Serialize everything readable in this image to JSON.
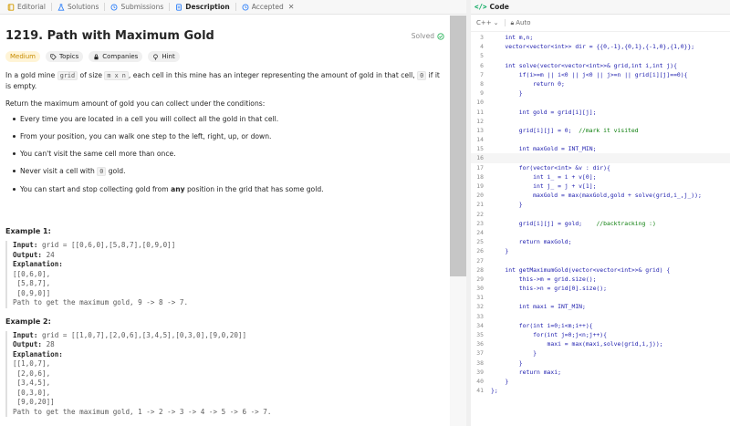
{
  "tabs": [
    {
      "label": "Editorial",
      "icon": "book-icon",
      "active": false
    },
    {
      "label": "Solutions",
      "icon": "flask-icon",
      "active": false
    },
    {
      "label": "Submissions",
      "icon": "history-icon",
      "active": false
    },
    {
      "label": "Description",
      "icon": "document-icon",
      "active": true
    },
    {
      "label": "Accepted",
      "icon": "history-icon",
      "active": false,
      "closable": true
    }
  ],
  "problem": {
    "title": "1219. Path with Maximum Gold",
    "solved_label": "Solved",
    "difficulty": "Medium",
    "tags": [
      "Topics",
      "Companies",
      "Hint"
    ],
    "description_parts": [
      "In a gold mine ",
      "grid",
      " of size ",
      "m x n",
      ", each cell in this mine has an integer representing the amount of gold in that cell, ",
      "0",
      " if it is empty."
    ],
    "return_text": "Return the maximum amount of gold you can collect under the conditions:",
    "rules": [
      {
        "pre": "Every time you are located in a cell you will collect all the gold in that cell.",
        "code": "",
        "bold": "",
        "post": ""
      },
      {
        "pre": "From your position, you can walk one step to the left, right, up, or down.",
        "code": "",
        "bold": "",
        "post": ""
      },
      {
        "pre": "You can't visit the same cell more than once.",
        "code": "",
        "bold": "",
        "post": ""
      },
      {
        "pre": "Never visit a cell with ",
        "code": "0",
        "bold": "",
        "post": " gold."
      },
      {
        "pre": "You can start and stop collecting gold from ",
        "code": "",
        "bold": "any",
        "post": " position in the grid that has some gold."
      }
    ],
    "examples": [
      {
        "title": "Example 1:",
        "input_label": "Input:",
        "input": " grid = [[0,6,0],[5,8,7],[0,9,0]]",
        "output_label": "Output:",
        "output": " 24",
        "explanation_label": "Explanation:",
        "explanation_lines": [
          "[[0,6,0],",
          " [5,8,7],",
          " [0,9,0]]",
          "Path to get the maximum gold, 9 -> 8 -> 7."
        ]
      },
      {
        "title": "Example 2:",
        "input_label": "Input:",
        "input": " grid = [[1,0,7],[2,0,6],[3,4,5],[0,3,0],[9,0,20]]",
        "output_label": "Output:",
        "output": " 28",
        "explanation_label": "Explanation:",
        "explanation_lines": [
          "[[1,0,7],",
          " [2,0,6],",
          " [3,4,5],",
          " [0,3,0],",
          " [9,0,20]]",
          "Path to get the maximum gold, 1 -> 2 -> 3 -> 4 -> 5 -> 6 -> 7."
        ]
      }
    ]
  },
  "code_panel": {
    "title": "Code",
    "language": "C++",
    "mode": "Auto",
    "lines": [
      {
        "n": "3",
        "t": "    int m,n;"
      },
      {
        "n": "4",
        "t": "    vector<vector<int>> dir = {{0,-1},{0,1},{-1,0},{1,0}};"
      },
      {
        "n": "5",
        "t": ""
      },
      {
        "n": "6",
        "t": "    int solve(vector<vector<int>>& grid,int i,int j){"
      },
      {
        "n": "7",
        "t": "        if(i>=m || i<0 || j<0 || j>=n || grid[i][j]==0){"
      },
      {
        "n": "8",
        "t": "            return 0;"
      },
      {
        "n": "9",
        "t": "        }"
      },
      {
        "n": "10",
        "t": ""
      },
      {
        "n": "11",
        "t": "        int gold = grid[i][j];"
      },
      {
        "n": "12",
        "t": ""
      },
      {
        "n": "13",
        "t": "        grid[i][j] = 0;  //mark it visited"
      },
      {
        "n": "14",
        "t": ""
      },
      {
        "n": "15",
        "t": "        int maxGold = INT_MIN;"
      },
      {
        "n": "16",
        "t": ""
      },
      {
        "n": "17",
        "t": "        for(vector<int> &v : dir){"
      },
      {
        "n": "18",
        "t": "            int i_ = i + v[0];"
      },
      {
        "n": "19",
        "t": "            int j_ = j + v[1];"
      },
      {
        "n": "20",
        "t": "            maxGold = max(maxGold,gold + solve(grid,i_,j_));"
      },
      {
        "n": "21",
        "t": "        }"
      },
      {
        "n": "22",
        "t": ""
      },
      {
        "n": "23",
        "t": "        grid[i][j] = gold;    //backtracking :)"
      },
      {
        "n": "24",
        "t": ""
      },
      {
        "n": "25",
        "t": "        return maxGold;"
      },
      {
        "n": "26",
        "t": "    }"
      },
      {
        "n": "27",
        "t": ""
      },
      {
        "n": "28",
        "t": "    int getMaximumGold(vector<vector<int>>& grid) {"
      },
      {
        "n": "29",
        "t": "        this->m = grid.size();"
      },
      {
        "n": "30",
        "t": "        this->n = grid[0].size();"
      },
      {
        "n": "31",
        "t": ""
      },
      {
        "n": "32",
        "t": "        int maxi = INT_MIN;"
      },
      {
        "n": "33",
        "t": ""
      },
      {
        "n": "34",
        "t": "        for(int i=0;i<m;i++){"
      },
      {
        "n": "35",
        "t": "            for(int j=0;j<n;j++){"
      },
      {
        "n": "36",
        "t": "                maxi = max(maxi,solve(grid,i,j));"
      },
      {
        "n": "37",
        "t": "            }"
      },
      {
        "n": "38",
        "t": "        }"
      },
      {
        "n": "39",
        "t": "        return maxi;"
      },
      {
        "n": "40",
        "t": "    }"
      },
      {
        "n": "41",
        "t": "};"
      }
    ]
  },
  "colors": {
    "accent_green": "#2db55d",
    "difficulty_medium": "#c78b00",
    "code_keyword": "#1c1cad",
    "code_comment": "#0a7d0a"
  }
}
